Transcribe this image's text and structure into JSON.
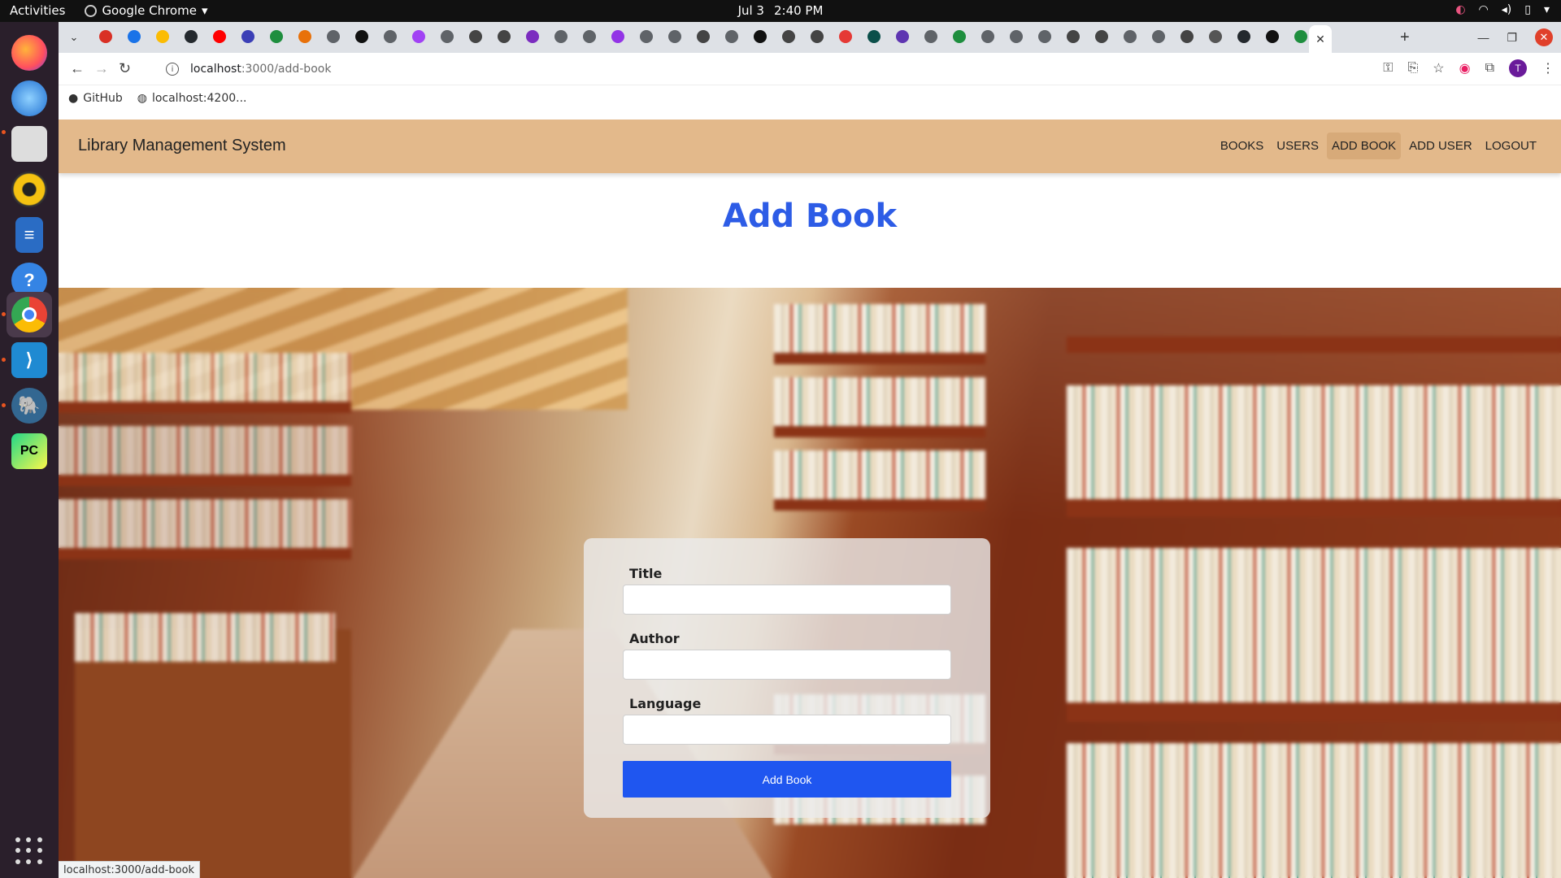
{
  "os_topbar": {
    "activities": "Activities",
    "app_name": "Google Chrome",
    "date": "Jul 3",
    "time": "2:40 PM"
  },
  "dock": {
    "items": [
      {
        "name": "firefox-icon",
        "color": "#ff7139"
      },
      {
        "name": "thunderbird-icon",
        "color": "#2a7de1"
      },
      {
        "name": "files-icon",
        "color": "#e8e8e8"
      },
      {
        "name": "rhythmbox-icon",
        "color": "#f5c211"
      },
      {
        "name": "writer-icon",
        "color": "#2a6cc4"
      },
      {
        "name": "help-icon",
        "color": "#3584e4"
      },
      {
        "name": "chrome-icon",
        "color": "#4285f4"
      },
      {
        "name": "vscode-icon",
        "color": "#23a9f2"
      },
      {
        "name": "pgadmin-icon",
        "color": "#336791"
      },
      {
        "name": "pycharm-icon",
        "color": "#21d789"
      }
    ]
  },
  "browser": {
    "active_tab_close": "✕",
    "new_tab": "+",
    "url_host": "localhost",
    "url_path": ":3000/add-book",
    "bookmarks": [
      {
        "label": "GitHub"
      },
      {
        "label": "localhost:4200..."
      }
    ],
    "avatar_letter": "T",
    "status_url": "localhost:3000/add-book"
  },
  "app": {
    "brand": "Library Management System",
    "nav": [
      {
        "label": "BOOKS"
      },
      {
        "label": "USERS"
      },
      {
        "label": "ADD BOOK"
      },
      {
        "label": "ADD USER"
      },
      {
        "label": "LOGOUT"
      }
    ],
    "heading": "Add Book",
    "form": {
      "title_label": "Title",
      "title_value": "",
      "author_label": "Author",
      "author_value": "",
      "language_label": "Language",
      "language_value": "",
      "submit_label": "Add Book"
    },
    "colors": {
      "navbar": "#e3b98b",
      "heading": "#2d5ce6",
      "button": "#1f56f0"
    }
  }
}
